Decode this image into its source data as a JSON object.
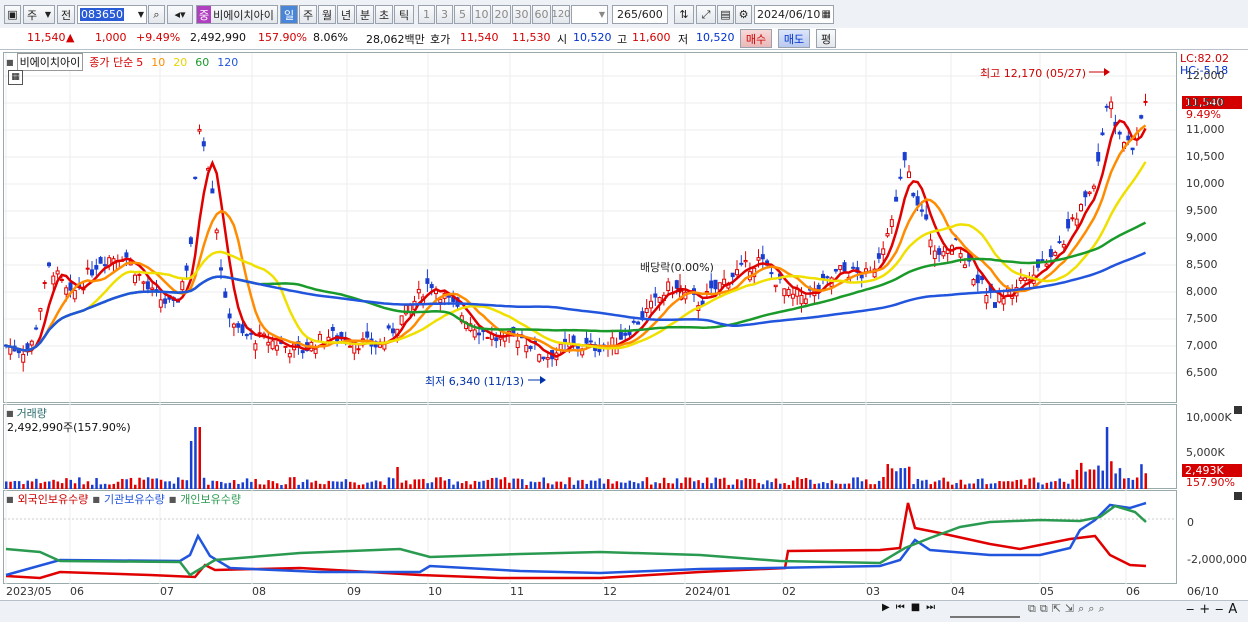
{
  "toolbar": {
    "type_select": "주",
    "range_select": "전",
    "code_value": "083650",
    "stock_name_tag": "중",
    "stock_name": "비에이치아이",
    "periods": [
      "일",
      "주",
      "월",
      "년",
      "분",
      "초",
      "틱"
    ],
    "active_period": "일",
    "intervals": [
      "1",
      "3",
      "5",
      "10",
      "20",
      "30",
      "60",
      "120"
    ],
    "count_value": "265",
    "count_total": "/600",
    "date_value": "2024/06/10"
  },
  "quote": {
    "price": "11,540",
    "change": "1,000",
    "change_pct": "+9.49%",
    "volume": "2,492,990",
    "volume_ratio": "157.90%",
    "turnover": "8.06%",
    "amount": "28,062백만",
    "ask_label": "호가",
    "ask": "11,540",
    "bid": "11,530",
    "open_label": "시",
    "open": "10,520",
    "high_label": "고",
    "high": "11,600",
    "low_label": "저",
    "low": "10,520",
    "buy_button": "매수",
    "sell_button": "매도",
    "eval_button": "평"
  },
  "price_panel": {
    "name": "비에이치아이",
    "indicator_label": "종가 단순",
    "ma_labels": [
      "5",
      "10",
      "20",
      "60",
      "120"
    ],
    "lc": "LC:82.02",
    "hc": "HC:-5.18",
    "high_annotation": "최고 12,170 (05/27)",
    "low_annotation": "최저 6,340 (11/13)",
    "dividend_annotation": "배당락(0.00%)",
    "price_tag": "11,540",
    "pct_tag": "9.49%",
    "y_ticks": [
      "12,000",
      "11,500",
      "11,000",
      "10,500",
      "10,000",
      "9,500",
      "9,000",
      "8,500",
      "8,000",
      "7,500",
      "7,000",
      "6,500"
    ]
  },
  "volume_panel": {
    "title": "거래량",
    "value_text": "2,492,990주(157.90%)",
    "y_ticks": [
      "10,000K",
      "5,000K"
    ],
    "vol_tag": "2,493K",
    "pct_tag": "157.90%"
  },
  "holding_panel": {
    "legend": [
      "외국인보유수량",
      "기관보유수량",
      "개인보유수량"
    ],
    "y_ticks": [
      "0",
      "-2,000,000"
    ]
  },
  "x_axis": {
    "labels": [
      "2023/05",
      "06",
      "07",
      "08",
      "09",
      "10",
      "11",
      "12",
      "2024/01",
      "02",
      "03",
      "04",
      "05",
      "06"
    ],
    "right_label": "06/10"
  },
  "colors": {
    "ma5": "#e00000",
    "ma10": "#ff8c00",
    "ma20": "#f0e000",
    "ma60": "#1a9a2a",
    "ma120": "#2255dd",
    "up": "#e00000",
    "down": "#1a3fd0",
    "foreign": "#e00000",
    "institution": "#2255dd",
    "individual": "#2a9a50"
  }
}
